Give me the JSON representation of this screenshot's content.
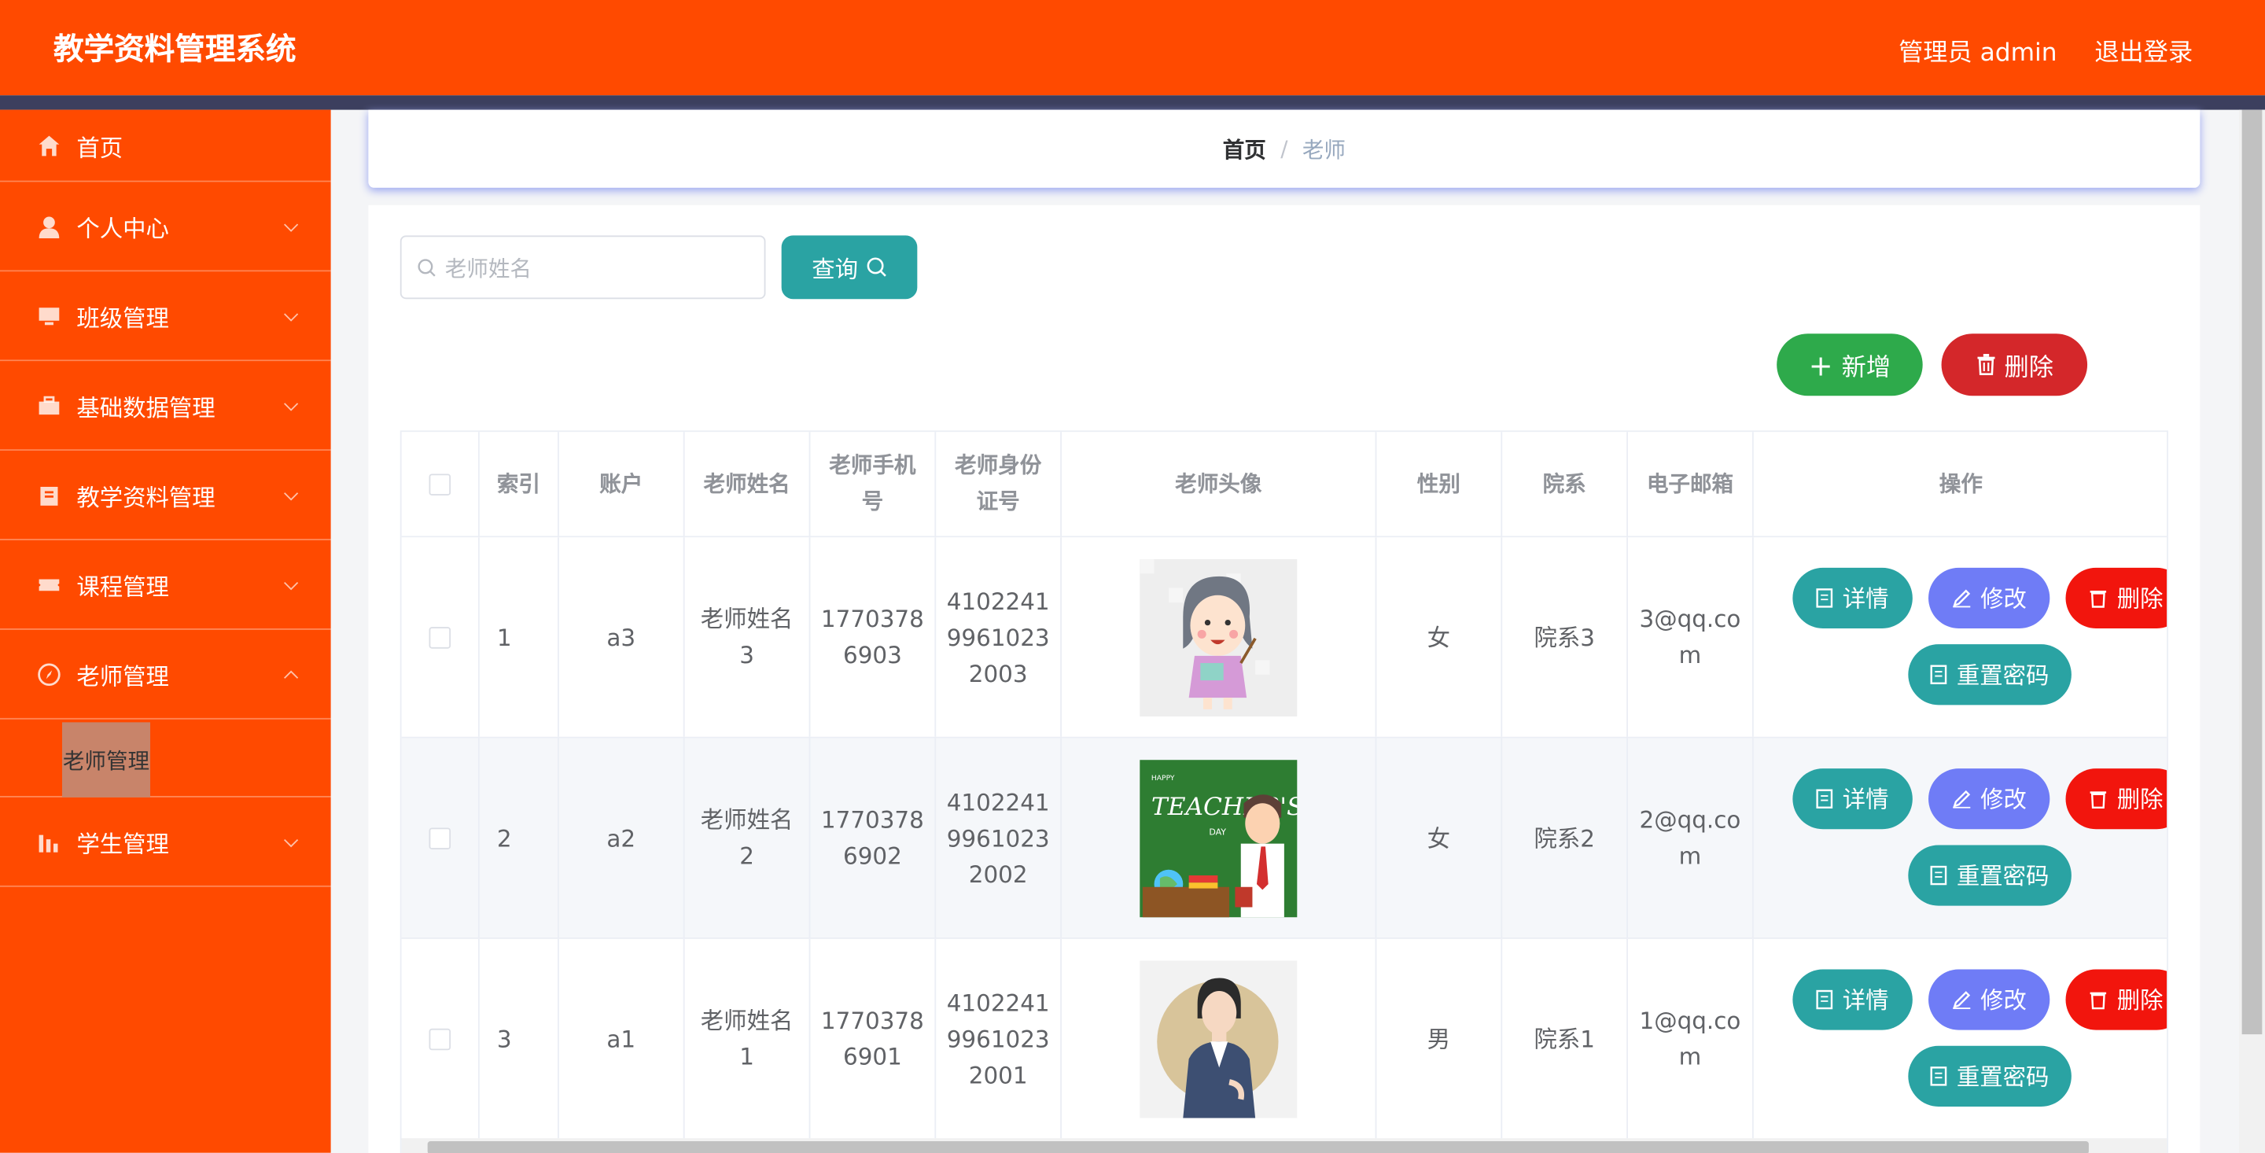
{
  "header": {
    "title": "教学资料管理系统",
    "user": "管理员 admin",
    "logout": "退出登录"
  },
  "sidebar": {
    "items": [
      {
        "label": "首页",
        "icon": "home-icon"
      },
      {
        "label": "个人中心",
        "icon": "user-icon"
      },
      {
        "label": "班级管理",
        "icon": "monitor-icon"
      },
      {
        "label": "基础数据管理",
        "icon": "briefcase-icon"
      },
      {
        "label": "教学资料管理",
        "icon": "clipboard-icon"
      },
      {
        "label": "课程管理",
        "icon": "ticket-icon"
      },
      {
        "label": "老师管理",
        "icon": "compass-icon"
      },
      {
        "label": "学生管理",
        "icon": "chart-icon"
      }
    ],
    "sub_active": "老师管理"
  },
  "breadcrumb": {
    "home": "首页",
    "sep": "/",
    "current": "老师"
  },
  "search": {
    "placeholder": "老师姓名",
    "button": "查询"
  },
  "toolbar": {
    "add": "新增",
    "delete": "删除"
  },
  "table": {
    "headers": [
      "索引",
      "账户",
      "老师姓名",
      "老师手机号",
      "老师身份证号",
      "老师头像",
      "性别",
      "院系",
      "电子邮箱",
      "操作"
    ],
    "rows": [
      {
        "index": "1",
        "account": "a3",
        "name": "老师姓名3",
        "phone": "17703786903",
        "idcard": "410224199610232003",
        "gender": "女",
        "dept": "院系3",
        "email": "3@qq.com"
      },
      {
        "index": "2",
        "account": "a2",
        "name": "老师姓名2",
        "phone": "17703786902",
        "idcard": "410224199610232002",
        "gender": "女",
        "dept": "院系2",
        "email": "2@qq.com"
      },
      {
        "index": "3",
        "account": "a1",
        "name": "老师姓名1",
        "phone": "17703786901",
        "idcard": "410224199610232001",
        "gender": "男",
        "dept": "院系1",
        "email": "1@qq.com"
      }
    ],
    "ops": {
      "detail": "详情",
      "edit": "修改",
      "remove": "删除",
      "reset": "重置密码"
    }
  },
  "colors": {
    "brand": "#ff4a00",
    "teal": "#2aa3a3",
    "green": "#2eaa4b",
    "red": "#d4272a",
    "purple": "#6f7cf6"
  }
}
